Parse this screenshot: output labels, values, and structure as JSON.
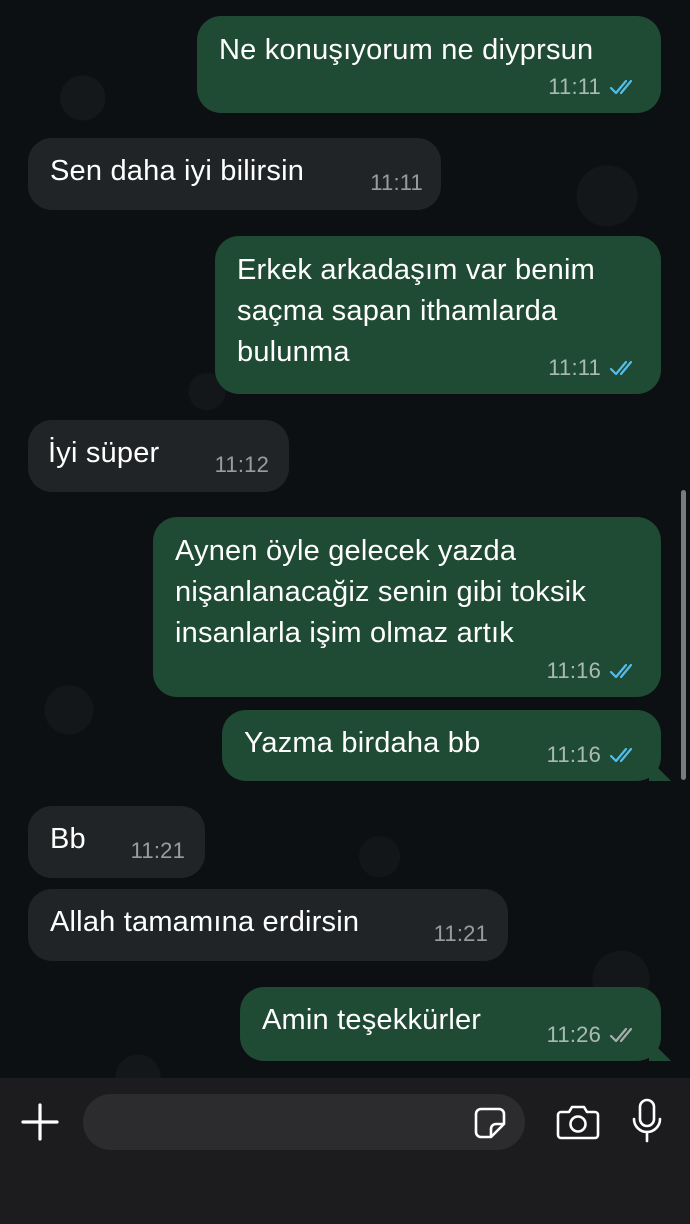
{
  "messages": [
    {
      "direction": "out",
      "text": "Ne konuşıyorum ne diyprsun",
      "time": "11:11",
      "status": "read"
    },
    {
      "direction": "in",
      "text": "Sen daha iyi bilirsin",
      "time": "11:11"
    },
    {
      "direction": "out",
      "text": "Erkek arkadaşım var benim\nsaçma sapan ithamlarda\nbulunma",
      "time": "11:11",
      "status": "read"
    },
    {
      "direction": "in",
      "text": "İyi süper",
      "time": "11:12"
    },
    {
      "direction": "out",
      "text": "Aynen öyle gelecek yazda\nnişanlanacağiz senin gibi toksik\ninsanlarla işim olmaz artık",
      "time": "11:16",
      "status": "read"
    },
    {
      "direction": "out",
      "text": "Yazma birdaha bb",
      "time": "11:16",
      "status": "read"
    },
    {
      "direction": "in",
      "text": "Bb",
      "time": "11:21"
    },
    {
      "direction": "in",
      "text": "Allah tamamına erdirsin",
      "time": "11:21"
    },
    {
      "direction": "out",
      "text": "Amin teşekkürler",
      "time": "11:26",
      "status": "delivered"
    }
  ],
  "composer": {
    "placeholder": "",
    "plus_icon": "plus-icon",
    "sticker_icon": "sticker-icon",
    "camera_icon": "camera-icon",
    "mic_icon": "microphone-icon"
  },
  "colors": {
    "outgoing_bubble": "#1f4a33",
    "incoming_bubble": "#212426",
    "read_tick": "#53bdeb",
    "delivered_tick": "#a8aeb0"
  }
}
